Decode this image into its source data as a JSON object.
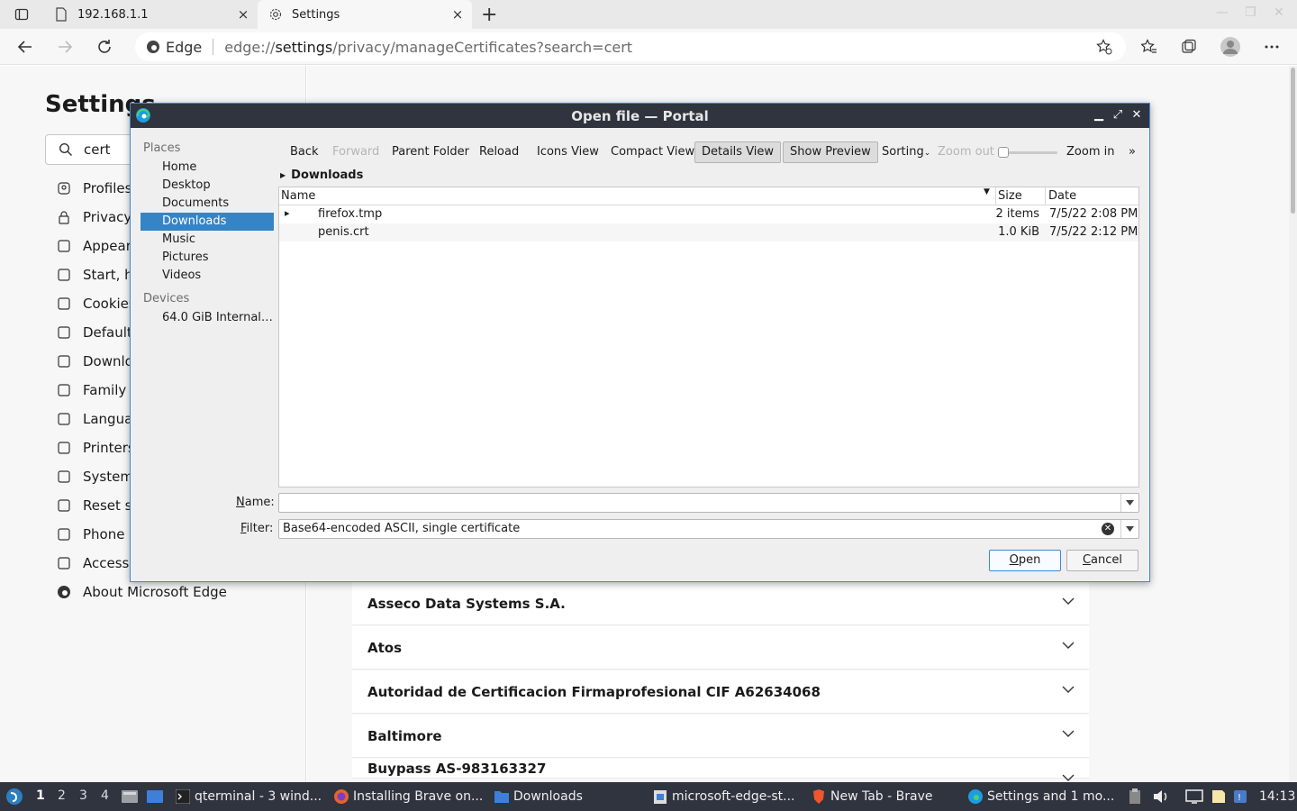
{
  "browser": {
    "tabs": [
      {
        "title": "192.168.1.1",
        "close": "×"
      },
      {
        "title": "Settings",
        "close": "×"
      }
    ],
    "new_tab": "+",
    "omnibox": {
      "badge": "Edge",
      "url_scheme": "edge://",
      "url_host": "settings",
      "url_path": "/privacy/manageCertificates?search=cert"
    }
  },
  "settings": {
    "title": "Settings",
    "search_value": "cert",
    "nav": [
      {
        "label": "Profiles",
        "icon": "profile-icon"
      },
      {
        "label": "Privacy",
        "icon": "lock-icon"
      },
      {
        "label": "Appear",
        "icon": "appearance-icon"
      },
      {
        "label": "Start, h",
        "icon": "start-page-icon"
      },
      {
        "label": "Cookies",
        "icon": "cookies-icon"
      },
      {
        "label": "Default",
        "icon": "default-browser-icon"
      },
      {
        "label": "Downlo",
        "icon": "download-icon"
      },
      {
        "label": "Family s",
        "icon": "family-icon"
      },
      {
        "label": "Langua",
        "icon": "language-icon"
      },
      {
        "label": "Printers",
        "icon": "printer-icon"
      },
      {
        "label": "System",
        "icon": "laptop-icon"
      },
      {
        "label": "Reset s",
        "icon": "reset-icon"
      },
      {
        "label": "Phone a",
        "icon": "phone-icon"
      },
      {
        "label": "Accessi",
        "icon": "accessibility-icon"
      },
      {
        "label": "About Microsoft Edge",
        "icon": "edge-icon"
      }
    ],
    "cert_authorities": [
      "Asseco Data Systems S.A.",
      "Atos",
      "Autoridad de Certificacion Firmaprofesional CIF A62634068",
      "Baltimore",
      "Buypass AS-983163327"
    ]
  },
  "dialog": {
    "title": "Open file — Portal",
    "places_header": "Places",
    "places": [
      "Home",
      "Desktop",
      "Documents",
      "Downloads",
      "Music",
      "Pictures",
      "Videos"
    ],
    "selected_place": "Downloads",
    "devices_header": "Devices",
    "devices": [
      "64.0 GiB Internal ..."
    ],
    "toolbar": {
      "back": "Back",
      "forward": "Forward",
      "parent": "Parent Folder",
      "reload": "Reload",
      "icons_view": "Icons View",
      "compact_view": "Compact View",
      "details_view": "Details View",
      "show_preview": "Show Preview",
      "sorting": "Sorting",
      "zoom_out": "Zoom out",
      "zoom_in": "Zoom in",
      "more": "»",
      "zoom_level": 0
    },
    "breadcrumb": "Downloads",
    "columns": [
      "Name",
      "Size",
      "Date"
    ],
    "files": [
      {
        "name": "firefox.tmp",
        "size": "2 items",
        "date": "7/5/22 2:08 PM",
        "expandable": true
      },
      {
        "name": "penis.crt",
        "size": "1.0 KiB",
        "date": "7/5/22 2:12 PM",
        "expandable": false
      }
    ],
    "name_label": "Name:",
    "name_value": "",
    "filter_label": "Filter:",
    "filter_value": "Base64-encoded ASCII, single certificate",
    "open": "Open",
    "cancel": "Cancel"
  },
  "taskbar": {
    "workspaces": [
      "1",
      "2",
      "3",
      "4"
    ],
    "tasks": [
      {
        "label": "qterminal - 3 wind...",
        "icon": "terminal-icon"
      },
      {
        "label": "Installing Brave on...",
        "icon": "firefox-icon"
      },
      {
        "label": "Downloads",
        "icon": "folder-icon"
      },
      {
        "label": "microsoft-edge-st...",
        "icon": "package-icon"
      },
      {
        "label": "New Tab - Brave",
        "icon": "brave-icon"
      },
      {
        "label": "Settings and 1 mo...",
        "icon": "edge-icon"
      }
    ],
    "clock": "14:13"
  }
}
